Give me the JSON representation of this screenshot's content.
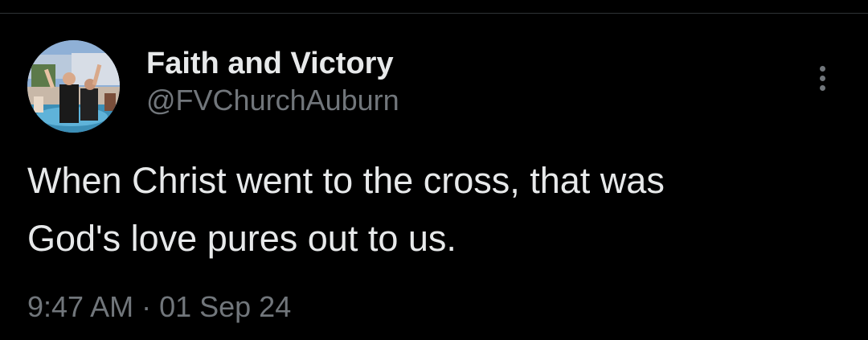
{
  "tweet": {
    "author": {
      "display_name": "Faith and Victory",
      "handle": "@FVChurchAuburn",
      "avatar_icon": "profile-photo"
    },
    "text_lines": [
      "When Christ went to the cross, that was",
      "God's love pures out to us."
    ],
    "timestamp": "9:47 AM · 01 Sep 24",
    "more_icon": "more-vertical-icon"
  },
  "colors": {
    "background": "#000000",
    "primary_text": "#e7e9ea",
    "secondary_text": "#71767b",
    "divider": "#2f3336"
  }
}
